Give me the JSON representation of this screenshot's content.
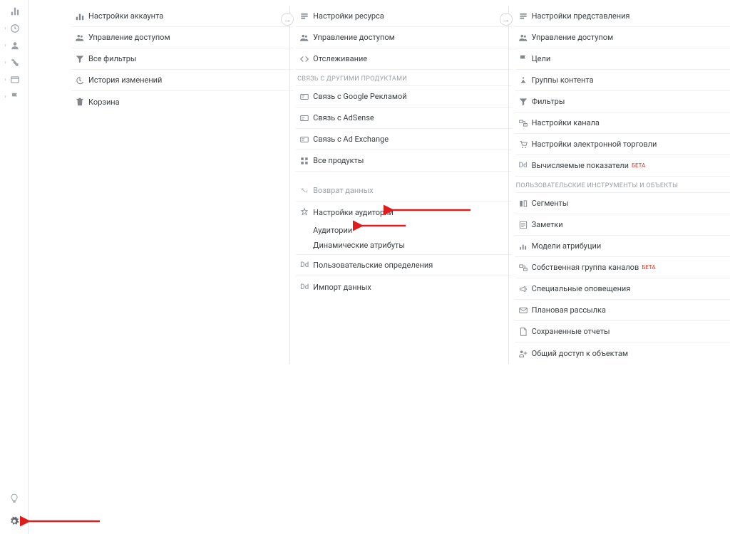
{
  "sidebar": {
    "items": [
      {
        "name": "home-icon"
      },
      {
        "name": "clock-icon"
      },
      {
        "name": "user-icon"
      },
      {
        "name": "flow-icon"
      },
      {
        "name": "card-icon"
      },
      {
        "name": "flag-icon"
      }
    ]
  },
  "account": {
    "settings_label": "Настройки аккаунта",
    "access_label": "Управление доступом",
    "filters_label": "Все фильтры",
    "history_label": "История изменений",
    "trash_label": "Корзина"
  },
  "property": {
    "settings_label": "Настройки ресурса",
    "access_label": "Управление доступом",
    "tracking_label": "Отслеживание",
    "link_section_header": "СВЯЗЬ С ДРУГИМИ ПРОДУКТАМИ",
    "link_ads_label": "Связь с Google Рекламой",
    "link_adsense_label": "Связь с AdSense",
    "link_adexchange_label": "Связь с Ad Exchange",
    "all_products_label": "Все продукты",
    "data_return_label": "Возврат данных",
    "audience_settings_label": "Настройки аудитории",
    "audience_sub1": "Аудитории",
    "audience_sub2": "Динамические атрибуты",
    "custom_defs_label": "Пользовательские определения",
    "import_label": "Импорт данных"
  },
  "view": {
    "settings_label": "Настройки представления",
    "access_label": "Управление доступом",
    "goals_label": "Цели",
    "content_groups_label": "Группы контента",
    "filters_label": "Фильтры",
    "channel_settings_label": "Настройки канала",
    "ecommerce_label": "Настройки электронной торговли",
    "calc_metrics_label": "Вычисляемые показатели",
    "calc_metrics_beta": "БЕТА",
    "tools_section_header": "ПОЛЬЗОВАТЕЛЬСКИЕ ИНСТРУМЕНТЫ И ОБЪЕКТЫ",
    "segments_label": "Сегменты",
    "notes_label": "Заметки",
    "attribution_label": "Модели атрибуции",
    "channel_group_label": "Собственная группа каналов",
    "channel_group_beta": "БЕТА",
    "alerts_label": "Специальные оповещения",
    "scheduled_label": "Плановая рассылка",
    "saved_reports_label": "Сохраненные отчеты",
    "share_label": "Общий доступ к объектам"
  }
}
